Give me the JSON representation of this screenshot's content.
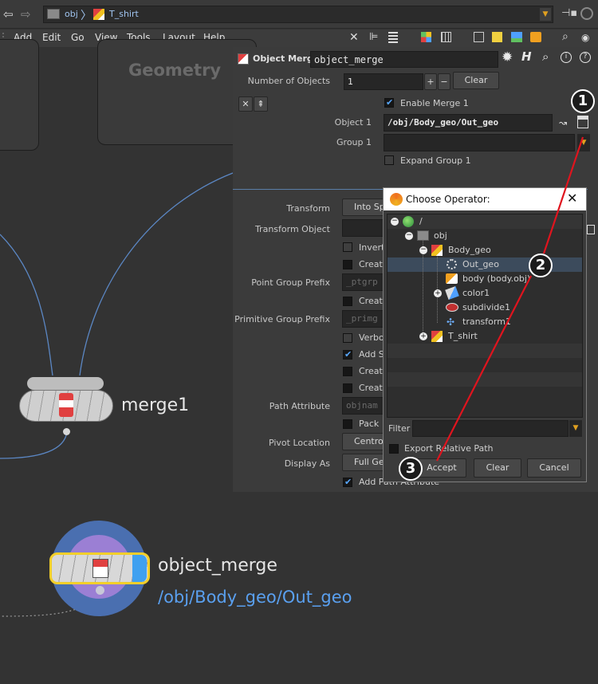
{
  "pathbar": {
    "crumb_root": "obj",
    "crumb_node": "T_shirt"
  },
  "menu": [
    "Add",
    "Edit",
    "Go",
    "View",
    "Tools",
    "Layout",
    "Help"
  ],
  "network": {
    "geometry_label": "Geometry",
    "merge_node": "merge1",
    "object_merge_node": "object_merge",
    "object_merge_path": "/obj/Body_geo/Out_geo"
  },
  "params": {
    "type_label": "Object Merge",
    "node_name": "object_merge",
    "num_objects_label": "Number of Objects",
    "num_objects_value": "1",
    "clear_label": "Clear",
    "enable_merge_label": "Enable Merge 1",
    "object1_label": "Object 1",
    "object1_value": "/obj/Body_geo/Out_geo",
    "group1_label": "Group 1",
    "expand_group_label": "Expand Group 1",
    "transform_label": "Transform",
    "transform_value": "Into Sp",
    "transform_object_label": "Transform Object",
    "invert_label": "Invert",
    "create_label": "Create",
    "point_group_prefix_label": "Point Group Prefix",
    "point_group_prefix_value": "_ptgrp",
    "primitive_group_prefix_label": "Primitive Group Prefix",
    "primitive_group_prefix_value": "_primg",
    "verbose_label": "Verbo",
    "add_s_label": "Add S",
    "path_attribute_label": "Path Attribute",
    "path_attribute_value": "objnam",
    "pack_label": "Pack",
    "pivot_location_label": "Pivot Location",
    "pivot_location_value": "Centro",
    "display_as_label": "Display As",
    "display_as_value": "Full Ge",
    "add_path_attribute_label": "Add Path Attribute"
  },
  "dialog": {
    "title": "Choose Operator:",
    "tree": {
      "root": "/",
      "obj": "obj",
      "body_geo": "Body_geo",
      "out_geo": "Out_geo",
      "body_obj": "body (body.obj)",
      "color1": "color1",
      "subdivide1": "subdivide1",
      "transform1": "transform1",
      "t_shirt": "T_shirt"
    },
    "filter_label": "Filter",
    "export_relative_label": "Export Relative Path",
    "accept_label": "Accept",
    "clear_label": "Clear",
    "cancel_label": "Cancel"
  },
  "callouts": [
    "1",
    "2",
    "3"
  ],
  "colors": {
    "accent_blue": "#58a8ff",
    "selection": "#3c4b5c",
    "annotation_red": "#e0141e",
    "node_purple": "#9b7fd4",
    "node_ring_blue": "#4a6fb0",
    "node_yellow": "#f2cf2a"
  },
  "icons": [
    "back-arrow-icon",
    "forward-arrow-icon",
    "obj-network-icon",
    "geometry-icon",
    "wrench-icon",
    "tree-icon",
    "list-icon",
    "grid-icon",
    "search-icon",
    "eye-icon",
    "gear-icon",
    "help-icon",
    "info-icon",
    "pin-icon",
    "operator-chooser-icon",
    "close-icon",
    "globe-icon",
    "null-icon"
  ]
}
